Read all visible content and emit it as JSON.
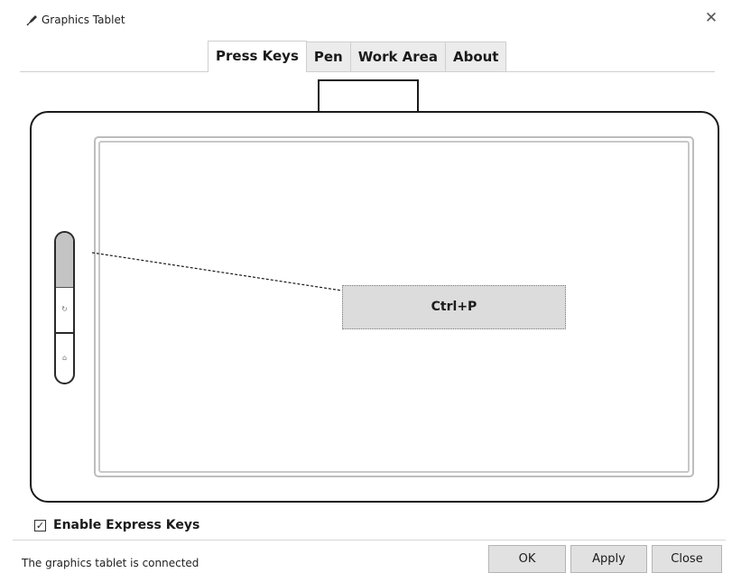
{
  "window": {
    "title": "Graphics Tablet",
    "close_glyph": "✕"
  },
  "tabs": [
    {
      "label": "Press Keys",
      "active": true
    },
    {
      "label": "Pen",
      "active": false
    },
    {
      "label": "Work Area",
      "active": false
    },
    {
      "label": "About",
      "active": false
    }
  ],
  "tablet": {
    "selected_key_assignment": "Ctrl+P",
    "express_keys": [
      "selected-key",
      "undo-icon",
      "home-icon"
    ]
  },
  "options": {
    "enable_express_keys_label": "Enable Express Keys",
    "enable_express_keys_checked": true,
    "check_glyph": "✓"
  },
  "footer": {
    "status": "The graphics tablet is connected",
    "ok_label": "OK",
    "apply_label": "Apply",
    "close_label": "Close"
  },
  "colors": {
    "selected_key": "#c4c4c4",
    "assignment_box": "#dcdcdc",
    "tablet_outline": "#1a1a1a"
  }
}
